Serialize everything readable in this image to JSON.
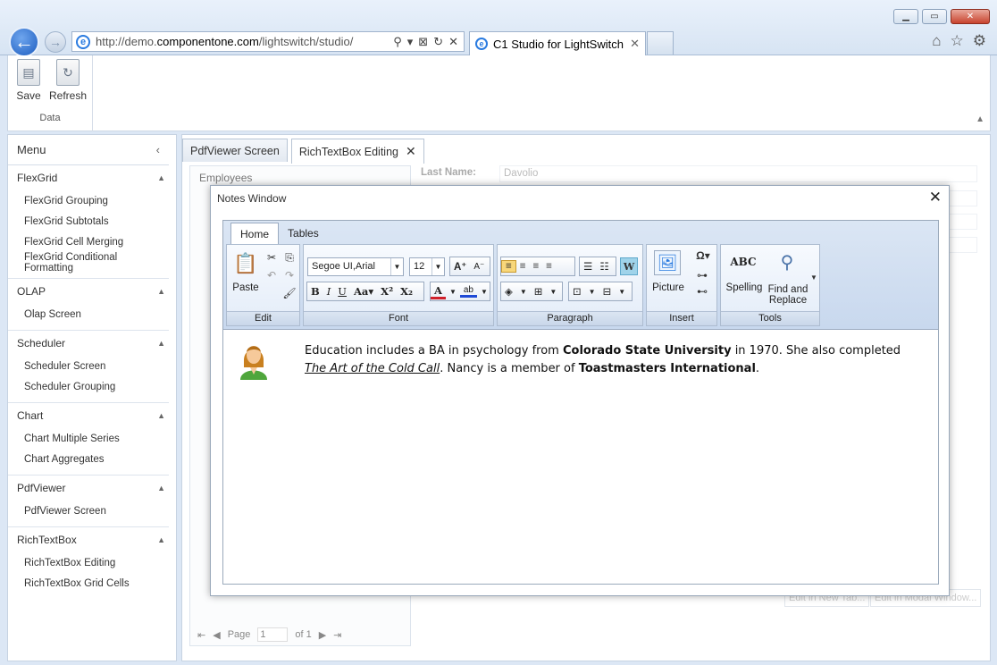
{
  "browser": {
    "url_prefix": "http://demo.",
    "url_domain": "componentone.com",
    "url_path": "/lightswitch/studio/",
    "tab_title": "C1 Studio for LightSwitch"
  },
  "ribbon": {
    "save_label": "Save",
    "refresh_label": "Refresh",
    "group_label": "Data"
  },
  "menu": {
    "title": "Menu",
    "sections": [
      {
        "title": "FlexGrid",
        "items": [
          "FlexGrid Grouping",
          "FlexGrid Subtotals",
          "FlexGrid Cell Merging",
          "FlexGrid Conditional Formatting"
        ]
      },
      {
        "title": "OLAP",
        "items": [
          "Olap Screen"
        ]
      },
      {
        "title": "Scheduler",
        "items": [
          "Scheduler Screen",
          "Scheduler Grouping"
        ]
      },
      {
        "title": "Chart",
        "items": [
          "Chart Multiple Series",
          "Chart Aggregates"
        ]
      },
      {
        "title": "PdfViewer",
        "items": [
          "PdfViewer Screen"
        ]
      },
      {
        "title": "RichTextBox",
        "items": [
          "RichTextBox Editing",
          "RichTextBox Grid Cells"
        ]
      }
    ]
  },
  "doc_tabs": [
    "PdfViewer Screen",
    "RichTextBox Editing"
  ],
  "background": {
    "employees_label": "Employees",
    "last_name_label": "Last Name:",
    "last_name_value": "Davolio",
    "pager_page": "Page",
    "pager_value": "1",
    "pager_of": "of 1",
    "btn_new_tab": "Edit in New Tab...",
    "btn_modal": "Edit in Modal Window..."
  },
  "modal": {
    "title": "Notes Window",
    "rte_tabs": [
      "Home",
      "Tables"
    ],
    "groups": {
      "edit": "Edit",
      "font": "Font",
      "paragraph": "Paragraph",
      "insert": "Insert",
      "tools": "Tools"
    },
    "paste_label": "Paste",
    "font_family": "Segoe UI,Arial",
    "font_size": "12",
    "picture_label": "Picture",
    "spelling_label": "Spelling",
    "find_replace_1": "Find and",
    "find_replace_2": "Replace",
    "notes": {
      "t1": "Education includes a BA in psychology from ",
      "b1": "Colorado State University",
      "t2": " in 1970. She also completed ",
      "i1": "The Art of the Cold Call",
      "t3": ". Nancy is a member of ",
      "b2": "Toastmasters International",
      "t4": "."
    }
  }
}
